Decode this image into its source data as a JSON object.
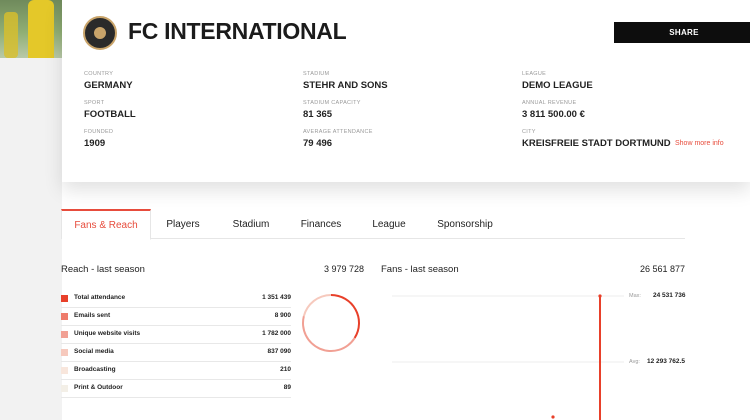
{
  "club": {
    "name": "FC INTERNATIONAL",
    "share_label": "SHARE",
    "show_more_label": "Show more info"
  },
  "info": {
    "country": {
      "label": "COUNTRY",
      "value": "GERMANY"
    },
    "stadium": {
      "label": "STADIUM",
      "value": "STEHR AND SONS"
    },
    "league": {
      "label": "LEAGUE",
      "value": "DEMO LEAGUE"
    },
    "sport": {
      "label": "SPORT",
      "value": "FOOTBALL"
    },
    "stadium_capacity": {
      "label": "STADIUM CAPACITY",
      "value": "81 365"
    },
    "annual_revenue": {
      "label": "ANNUAL REVENUE",
      "value": "3 811 500.00 €"
    },
    "founded": {
      "label": "FOUNDED",
      "value": "1909"
    },
    "average_attendance": {
      "label": "AVERAGE ATTENDANCE",
      "value": "79 496"
    },
    "city": {
      "label": "CITY",
      "value": "KREISFREIE STADT DORTMUND"
    }
  },
  "tabs": [
    {
      "label": "Fans & Reach",
      "active": true
    },
    {
      "label": "Players",
      "active": false
    },
    {
      "label": "Stadium",
      "active": false
    },
    {
      "label": "Finances",
      "active": false
    },
    {
      "label": "League",
      "active": false
    },
    {
      "label": "Sponsorship",
      "active": false
    }
  ],
  "reach": {
    "title": "Reach - last season",
    "total": "3 979 728",
    "rows": [
      {
        "name": "Total attendance",
        "value": "1 351 439",
        "color": "#e8402a"
      },
      {
        "name": "Emails sent",
        "value": "8 900",
        "color": "#ee7b6b"
      },
      {
        "name": "Unique website visits",
        "value": "1 782 000",
        "color": "#f1a094"
      },
      {
        "name": "Social media",
        "value": "837 090",
        "color": "#f6c9bd"
      },
      {
        "name": "Broadcasting",
        "value": "210",
        "color": "#f8e6dc"
      },
      {
        "name": "Print & Outdoor",
        "value": "89",
        "color": "#f3efe7"
      }
    ]
  },
  "fans": {
    "title": "Fans - last season",
    "total": "26 561 877",
    "max_label": "Max:",
    "max_value": "24 531 736",
    "avg_label": "Avg:",
    "avg_value": "12 293 762.5"
  },
  "colors": {
    "accent": "#e74c3c",
    "dark": "#0d0d0d"
  }
}
